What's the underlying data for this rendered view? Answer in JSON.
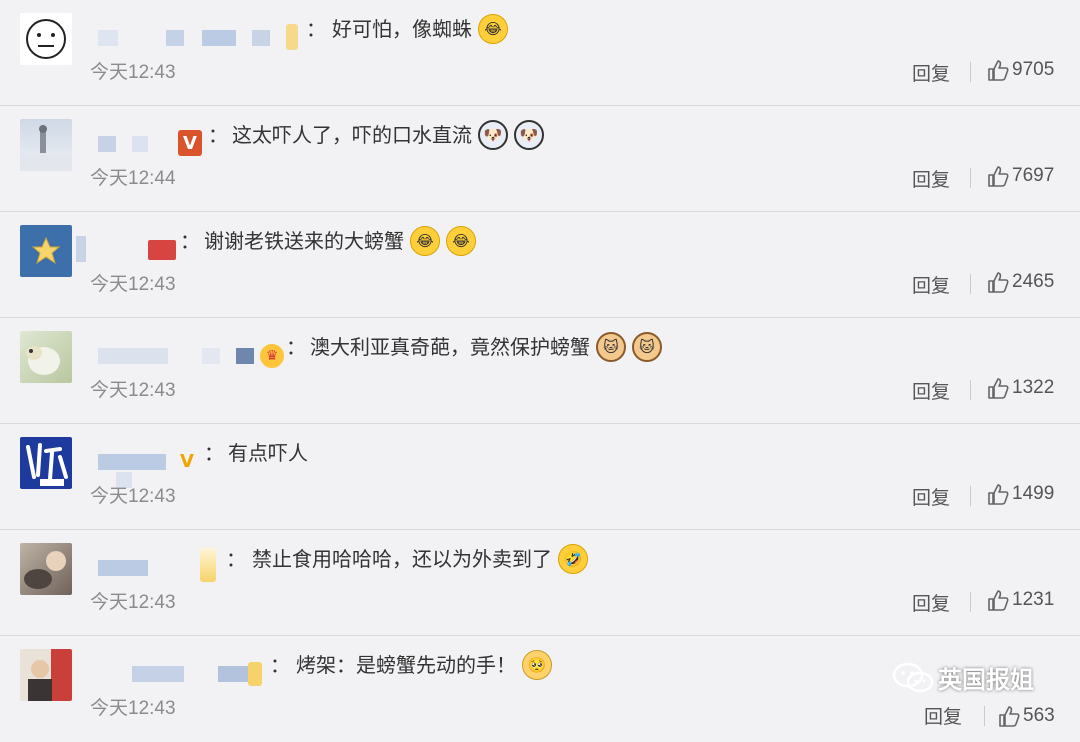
{
  "comments": [
    {
      "sep": "：",
      "text": "好可怕，像蜘蛛",
      "time": "今天12:43",
      "reply": "回复",
      "likes": "9705",
      "emoji": [
        "laugh-cry-emoji"
      ]
    },
    {
      "sep": "：",
      "text": "这太吓人了，吓的口水直流",
      "time": "今天12:44",
      "reply": "回复",
      "likes": "7697",
      "badge": "V",
      "emoji": [
        "drool-dog-emoji",
        "drool-dog-emoji"
      ]
    },
    {
      "sep": "：",
      "text": "谢谢老铁送来的大螃蟹",
      "time": "今天12:43",
      "reply": "回复",
      "likes": "2465",
      "emoji": [
        "laugh-cry-emoji",
        "laugh-cry-emoji"
      ]
    },
    {
      "sep": "：",
      "text": "澳大利亚真奇葩，竟然保护螃蟹",
      "time": "今天12:43",
      "reply": "回复",
      "likes": "1322",
      "emoji": [
        "cat-emoji",
        "cat-emoji"
      ]
    },
    {
      "sep": "：",
      "text": "有点吓人",
      "time": "今天12:43",
      "reply": "回复",
      "likes": "1499",
      "badge": "V",
      "emoji": []
    },
    {
      "sep": "：",
      "text": "禁止食用哈哈哈，还以为外卖到了",
      "time": "今天12:43",
      "reply": "回复",
      "likes": "1231",
      "emoji": [
        "laugh-roll-emoji"
      ]
    },
    {
      "sep": "：",
      "text": "烤架：是螃蟹先动的手！",
      "time": "今天12:43",
      "reply": "回复",
      "likes": "563",
      "emoji": [
        "pleading-emoji"
      ]
    }
  ],
  "avatar_icons": [
    "neutral-face-icon",
    "snow-figure-icon",
    "star-icon",
    "parrot-icon",
    "calligraphy-icon",
    "photo-avatar-icon",
    "portrait-avatar-icon"
  ],
  "watermark": {
    "text": "英国报姐",
    "icon": "wechat-icon"
  },
  "colors": {
    "background": "#f2f2f5",
    "divider": "#d9d9de",
    "text": "#333333",
    "muted": "#8b8b8b",
    "blur": "#c9d3e6",
    "vip_badge": "#f0a400"
  }
}
